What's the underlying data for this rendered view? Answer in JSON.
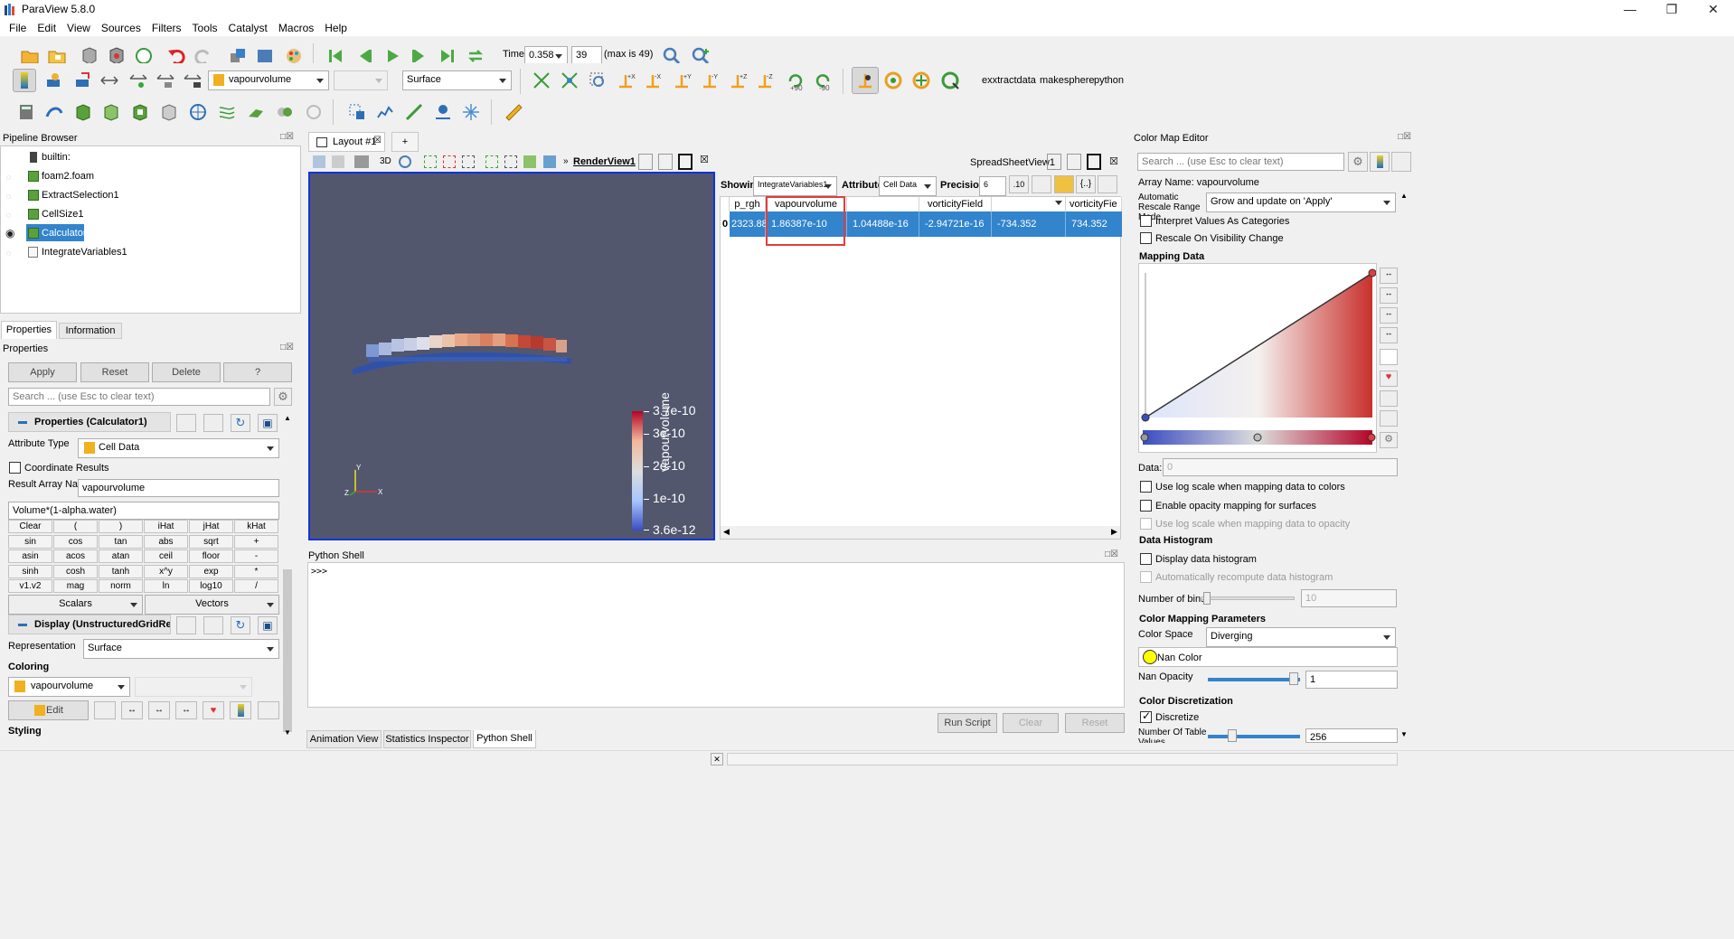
{
  "app": {
    "title": "ParaView 5.8.0"
  },
  "menu": [
    "File",
    "Edit",
    "View",
    "Sources",
    "Filters",
    "Tools",
    "Catalyst",
    "Macros",
    "Help"
  ],
  "time": {
    "label": "Time:",
    "value": "0.358",
    "step": "39",
    "max_label": "(max is 49)"
  },
  "toolbar2": {
    "array_select": "vapourvolume",
    "component_select": "",
    "representation": "Surface",
    "macros": [
      "exxtractdata",
      "makesphere",
      "python"
    ],
    "rot_plus": "+90",
    "rot_minus": "-90"
  },
  "pipeline": {
    "title": "Pipeline Browser",
    "items": [
      {
        "label": "builtin:"
      },
      {
        "label": "foam2.foam"
      },
      {
        "label": "ExtractSelection1"
      },
      {
        "label": "CellSize1"
      },
      {
        "label": "Calculator1"
      },
      {
        "label": "IntegrateVariables1"
      }
    ]
  },
  "props": {
    "tabs": [
      "Properties",
      "Information"
    ],
    "title": "Properties",
    "apply": "Apply",
    "reset": "Reset",
    "delete": "Delete",
    "help": "?",
    "search_placeholder": "Search ... (use Esc to clear text)",
    "section_calc": "Properties (Calculator1)",
    "attribute_type_label": "Attribute Type",
    "attribute_type": "Cell Data",
    "coord_results": "Coordinate Results",
    "result_name_label": "Result Array Name",
    "result_name": "vapourvolume",
    "expression": "Volume*(1-alpha.water)",
    "calc_keys": [
      [
        "Clear",
        "(",
        ")",
        "iHat",
        "jHat",
        "kHat"
      ],
      [
        "sin",
        "cos",
        "tan",
        "abs",
        "sqrt",
        "+"
      ],
      [
        "asin",
        "acos",
        "atan",
        "ceil",
        "floor",
        "-"
      ],
      [
        "sinh",
        "cosh",
        "tanh",
        "x^y",
        "exp",
        "*"
      ],
      [
        "v1.v2",
        "mag",
        "norm",
        "ln",
        "log10",
        "/"
      ]
    ],
    "scalars": "Scalars",
    "vectors": "Vectors",
    "section_display": "Display (UnstructuredGridRepr",
    "representation_label": "Representation",
    "representation": "Surface",
    "coloring_label": "Coloring",
    "coloring": "vapourvolume",
    "edit": "Edit",
    "styling_label": "Styling"
  },
  "layout": {
    "tab": "Layout #1",
    "plus": "+"
  },
  "render": {
    "toolbar_3d": "3D",
    "view_name": "RenderView1",
    "legend_title": "vapourvolume",
    "legend_ticks": [
      "3.7e-10",
      "3e-10",
      "2e-10",
      "1e-10",
      "3.6e-12"
    ],
    "axes": {
      "y": "Y",
      "z": "Z",
      "x": "X"
    },
    "bg": "#52576e"
  },
  "spreadsheet": {
    "view_name": "SpreadSheetView1",
    "showing_label": "Showing",
    "showing": "IntegrateVariables1",
    "attribute_label": "Attribute:",
    "attribute": "Cell Data",
    "precision_label": "Precision:",
    "precision": "6",
    "prec_btn": ".10",
    "columns": [
      "p_rgh",
      "vapourvolume",
      "vorticityField",
      "",
      "",
      "vorticityFie"
    ],
    "row_index": "0",
    "row": [
      "2323.88",
      "1.86387e-10",
      "1.04488e-16",
      "-2.94721e-16",
      "-734.352",
      "734.352"
    ]
  },
  "python": {
    "title": "Python Shell",
    "prompt": ">>>",
    "run": "Run Script",
    "clear": "Clear",
    "reset": "Reset"
  },
  "bottom_tabs": [
    "Animation View",
    "Statistics Inspector",
    "Python Shell"
  ],
  "cme": {
    "title": "Color Map Editor",
    "search_placeholder": "Search ... (use Esc to clear text)",
    "array_name": "Array Name: vapourvolume",
    "auto_rescale_label": "Automatic Rescale Range Mode",
    "auto_rescale": "Grow and update on 'Apply'",
    "interpret": "Interpret Values As Categories",
    "rescale_vis": "Rescale On Visibility Change",
    "mapping_data": "Mapping Data",
    "data_label": "Data:",
    "data_value": "0",
    "log_scale": "Use log scale when mapping data to colors",
    "enable_opacity": "Enable opacity mapping for surfaces",
    "log_opacity": "Use log scale when mapping data to opacity",
    "histogram_title": "Data Histogram",
    "display_hist": "Display data histogram",
    "auto_recompute": "Automatically recompute data histogram",
    "bins_label": "Number of bins:",
    "bins": "10",
    "params_title": "Color Mapping Parameters",
    "color_space_label": "Color Space",
    "color_space": "Diverging",
    "nan_color": "Nan Color",
    "nan_opacity_label": "Nan Opacity",
    "nan_opacity": "1",
    "discretization_title": "Color Discretization",
    "discretize": "Discretize",
    "table_values_label": "Number Of Table Values",
    "table_values": "256"
  },
  "colors": {
    "accent": "#3284cc",
    "highlight": "#e23d3d",
    "nan": "#ffff00"
  }
}
